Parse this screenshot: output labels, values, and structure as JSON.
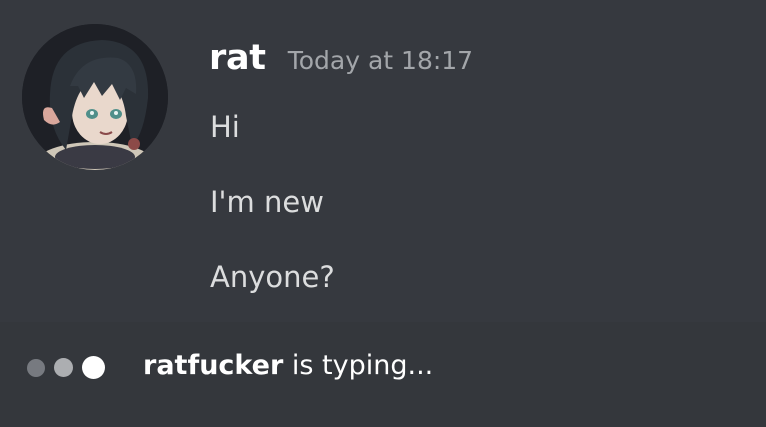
{
  "message": {
    "username": "rat",
    "timestamp": "Today at 18:17",
    "lines": [
      "Hi",
      "I'm new",
      "Anyone?"
    ],
    "avatar": "anime-girl-avatar"
  },
  "typing_indicator": {
    "user": "ratfucker",
    "text": "is typing..."
  },
  "colors": {
    "background": "#36393f",
    "username": "#ffffff",
    "timestamp": "#a3a6aa",
    "message_text": "#dcddde"
  }
}
